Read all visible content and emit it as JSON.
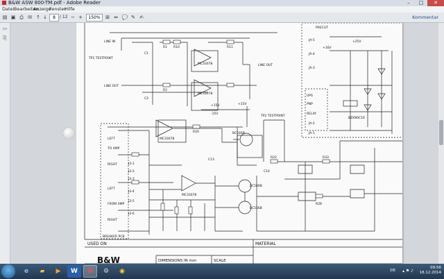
{
  "window": {
    "title": "B&W ASW 800-TM.pdf - Adobe Reader",
    "btn_minimize": "–",
    "btn_maximize": "□",
    "btn_close": "✕"
  },
  "menu": [
    "Datei",
    "Bearbeiten",
    "Anzeige",
    "Fenster",
    "Hilfe"
  ],
  "toolbar": {
    "current_page": "8",
    "total_pages": "/ 12",
    "zoom": "150%",
    "comment_label": "Kommentar"
  },
  "schematic": {
    "labels": {
      "line_in": "LINE IN",
      "line_out_left": "LINE OUT",
      "line_out_right": "LINE OUT",
      "tp1": "TP1 TESTPOINT",
      "to_amp": "TO AMP",
      "from_amp": "FROM AMP",
      "breaker_pcb": "BREAKER PCB",
      "left1": "LEFT",
      "right1": "RIGHT",
      "left2": "LEFT",
      "right2": "RIGHT",
      "mc1": "MC33078",
      "mc2": "MC33078",
      "mc3": "MC33078",
      "mc4": "MC33078",
      "bc1": "BC546B",
      "bc2": "BC546B",
      "bc3": "BC556B",
      "tp_relay": "TP2 TESTPOINT",
      "precut": "PRECUT",
      "relay": "RELAY",
      "ups": "UPS",
      "pnp": "PNP",
      "bzx": "BZX80C16",
      "plus15v": "+15V",
      "minus15v": "-15V",
      "plus16v": "+16V",
      "plus25v": "+25V",
      "plus15v_b": "+15V",
      "j1": "J3-1",
      "j2": "J3-2",
      "j3": "J3-3",
      "j4": "J3-4",
      "j5": "J3-5",
      "j6": "J3-6",
      "s1": "JA-5",
      "s2": "JA-4",
      "s3": "JA-3",
      "s4": "JA-2",
      "s5": "JA-1",
      "r1": "R1",
      "c1": "C1",
      "r2": "R2",
      "c2": "C2",
      "r3": "R10",
      "r4": "R11",
      "r5": "R20",
      "c3": "C13",
      "c4": "C14",
      "r6": "R22",
      "r7": "R33",
      "r8": "R28"
    },
    "titleblock": {
      "used_on": "USED ON",
      "material": "MATERIAL",
      "dimensions": "DIMENSIONS IN mm",
      "scale": "SCALE",
      "logo": "B&W"
    }
  },
  "taskbar": {
    "apps": [
      "Internet Explorer",
      "Windows Explorer",
      "Media Player",
      "Word",
      "Adobe Reader",
      "Tools",
      "Chrome"
    ],
    "lang": "DE",
    "time": "09:56",
    "date": "18.12.2014"
  }
}
